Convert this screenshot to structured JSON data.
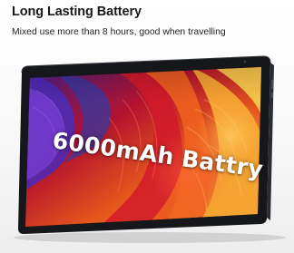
{
  "feature": {
    "title": "Long Lasting Battery",
    "subtitle": "Mixed use more than 8 hours, good when travelling"
  },
  "product_image": {
    "screen_text": "6000mAh Battry",
    "colors": {
      "bezel": "#16171a",
      "wallpaper_red": "#d21a2a",
      "wallpaper_orange": "#f0921a",
      "wallpaper_purple": "#6a2ab0",
      "wallpaper_blue": "#2a3fb8"
    }
  }
}
